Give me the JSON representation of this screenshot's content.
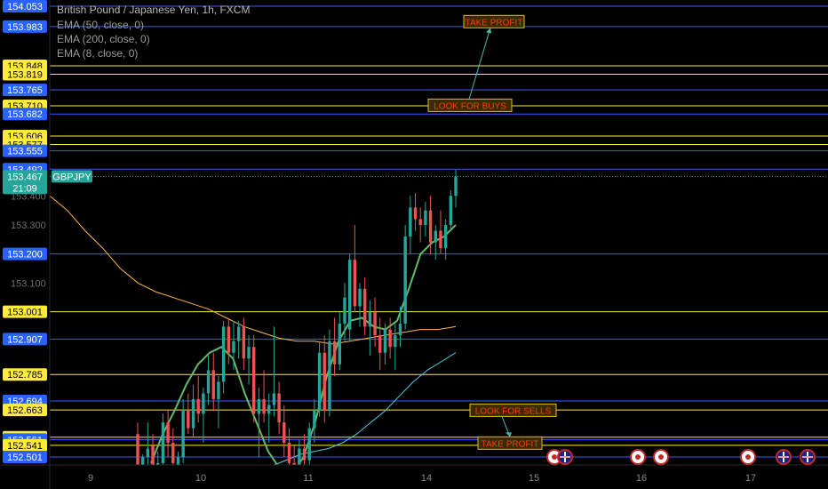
{
  "header": {
    "title": "British Pound / Japanese Yen, 1h, FXCM",
    "indicators": [
      "EMA (50, close, 0)",
      "EMA (200, close, 0)",
      "EMA (8, close, 0)"
    ]
  },
  "colors": {
    "background": "#000000",
    "up_candle": "#26a69a",
    "down_candle": "#ef5350",
    "blue_level": "#3d5afe",
    "yellow_level": "#ffeb3b",
    "ema50": "#ffb74d",
    "ema200": "#4dd0e1",
    "ema8": "#66bb6a",
    "annotation_text": "#ff3d00"
  },
  "chart_data": {
    "type": "candlestick",
    "symbol": "GBPJPY",
    "timeframe": "1h",
    "ylim": [
      152.45,
      154.08
    ],
    "x_ticks": [
      "9",
      "10",
      "11",
      "14",
      "15",
      "16",
      "17"
    ],
    "y_ticks": [
      "153.400",
      "153.300",
      "153.100"
    ],
    "levels": [
      {
        "price": 154.053,
        "color": "blue"
      },
      {
        "price": 153.983,
        "color": "blue"
      },
      {
        "price": 153.848,
        "color": "yellow"
      },
      {
        "price": 153.819,
        "color": "yellow"
      },
      {
        "price": 153.765,
        "color": "blue"
      },
      {
        "price": 153.71,
        "color": "yellow"
      },
      {
        "price": 153.682,
        "color": "blue"
      },
      {
        "price": 153.606,
        "color": "yellow"
      },
      {
        "price": 153.577,
        "color": "yellow"
      },
      {
        "price": 153.555,
        "color": "blue"
      },
      {
        "price": 153.492,
        "color": "blue"
      },
      {
        "price": 153.2,
        "color": "blue"
      },
      {
        "price": 153.001,
        "color": "yellow"
      },
      {
        "price": 152.907,
        "color": "blue"
      },
      {
        "price": 152.785,
        "color": "yellow"
      },
      {
        "price": 152.694,
        "color": "blue"
      },
      {
        "price": 152.663,
        "color": "yellow"
      },
      {
        "price": 152.569,
        "color": "yellow"
      },
      {
        "price": 152.561,
        "color": "blue"
      },
      {
        "price": 152.541,
        "color": "yellow"
      },
      {
        "price": 152.501,
        "color": "blue"
      }
    ],
    "current": {
      "symbol": "GBPJPY",
      "price": "153.467",
      "countdown": "21:09"
    },
    "annotations": [
      {
        "text": "TAKE PROFIT",
        "price": 154.0
      },
      {
        "text": "LOOK FOR BUYS",
        "price": 153.712
      },
      {
        "text": "LOOK FOR SELLS",
        "price": 152.662
      },
      {
        "text": "TAKE PROFIT",
        "price": 152.549
      }
    ],
    "candles": [
      [
        152.58,
        152.62,
        152.4,
        152.45
      ],
      [
        152.44,
        152.51,
        152.38,
        152.5
      ],
      [
        152.5,
        152.62,
        152.46,
        152.53
      ],
      [
        152.54,
        152.58,
        152.42,
        152.45
      ],
      [
        152.45,
        152.52,
        152.38,
        152.48
      ],
      [
        152.48,
        152.65,
        152.45,
        152.62
      ],
      [
        152.62,
        152.66,
        152.5,
        152.55
      ],
      [
        152.55,
        152.6,
        152.44,
        152.48
      ],
      [
        152.47,
        152.52,
        152.4,
        152.5
      ],
      [
        152.5,
        152.7,
        152.48,
        152.66
      ],
      [
        152.66,
        152.72,
        152.58,
        152.6
      ],
      [
        152.6,
        152.75,
        152.57,
        152.7
      ],
      [
        152.7,
        152.78,
        152.62,
        152.65
      ],
      [
        152.65,
        152.74,
        152.55,
        152.72
      ],
      [
        152.72,
        152.85,
        152.68,
        152.8
      ],
      [
        152.8,
        152.86,
        152.66,
        152.7
      ],
      [
        152.7,
        152.78,
        152.6,
        152.76
      ],
      [
        152.76,
        152.97,
        152.72,
        152.95
      ],
      [
        152.95,
        152.98,
        152.82,
        152.86
      ],
      [
        152.86,
        152.97,
        152.8,
        152.9
      ],
      [
        152.9,
        152.97,
        152.84,
        152.95
      ],
      [
        152.95,
        152.98,
        152.8,
        152.84
      ],
      [
        152.84,
        152.92,
        152.75,
        152.88
      ],
      [
        152.88,
        152.92,
        152.62,
        152.65
      ],
      [
        152.65,
        152.74,
        152.5,
        152.7
      ],
      [
        152.7,
        152.8,
        152.62,
        152.65
      ],
      [
        152.65,
        152.72,
        152.55,
        152.68
      ],
      [
        152.68,
        152.95,
        152.64,
        152.72
      ],
      [
        152.72,
        152.76,
        152.58,
        152.62
      ],
      [
        152.62,
        152.68,
        152.5,
        152.55
      ],
      [
        152.55,
        152.6,
        152.44,
        152.48
      ],
      [
        152.48,
        152.54,
        152.4,
        152.45
      ],
      [
        152.44,
        152.56,
        152.42,
        152.53
      ],
      [
        152.53,
        152.58,
        152.45,
        152.49
      ],
      [
        152.49,
        152.62,
        152.47,
        152.6
      ],
      [
        152.6,
        152.7,
        152.55,
        152.66
      ],
      [
        152.66,
        152.9,
        152.64,
        152.86
      ],
      [
        152.86,
        152.92,
        152.62,
        152.66
      ],
      [
        152.66,
        152.94,
        152.64,
        152.9
      ],
      [
        152.9,
        152.98,
        152.78,
        152.82
      ],
      [
        152.82,
        153.0,
        152.8,
        152.96
      ],
      [
        152.96,
        153.1,
        152.9,
        153.05
      ],
      [
        152.94,
        153.2,
        152.9,
        153.18
      ],
      [
        153.18,
        153.3,
        153.0,
        153.02
      ],
      [
        153.02,
        153.1,
        152.95,
        153.08
      ],
      [
        153.08,
        153.12,
        152.92,
        152.95
      ],
      [
        152.95,
        153.04,
        152.85,
        153.0
      ],
      [
        153.0,
        153.05,
        152.88,
        152.92
      ],
      [
        152.92,
        152.98,
        152.8,
        152.86
      ],
      [
        152.86,
        152.96,
        152.82,
        152.94
      ],
      [
        152.94,
        152.98,
        152.84,
        152.88
      ],
      [
        152.88,
        152.96,
        152.8,
        152.92
      ],
      [
        152.92,
        153.02,
        152.88,
        152.96
      ],
      [
        152.96,
        153.3,
        152.94,
        153.26
      ],
      [
        153.26,
        153.4,
        153.2,
        153.36
      ],
      [
        153.36,
        153.41,
        153.28,
        153.32
      ],
      [
        153.32,
        153.36,
        153.24,
        153.3
      ],
      [
        153.3,
        153.38,
        153.26,
        153.35
      ],
      [
        153.35,
        153.4,
        153.2,
        153.24
      ],
      [
        153.24,
        153.3,
        153.18,
        153.28
      ],
      [
        153.28,
        153.35,
        153.2,
        153.22
      ],
      [
        153.22,
        153.32,
        153.18,
        153.3
      ],
      [
        153.3,
        153.42,
        153.28,
        153.4
      ],
      [
        153.4,
        153.49,
        153.36,
        153.467
      ]
    ],
    "ema50": [
      [
        152.44,
        152.42
      ],
      [
        152.48,
        152.47
      ],
      [
        152.54,
        152.49
      ],
      [
        152.58,
        152.51
      ],
      [
        152.61,
        152.52
      ],
      [
        152.64,
        152.53
      ],
      [
        152.68,
        152.55
      ],
      [
        152.72,
        152.58
      ],
      [
        152.76,
        152.62
      ],
      [
        152.8,
        152.66
      ],
      [
        152.84,
        152.71
      ],
      [
        152.88,
        152.76
      ],
      [
        152.92,
        152.8
      ],
      [
        152.96,
        152.83
      ],
      [
        152.99,
        152.86
      ]
    ],
    "ema200": [
      [
        152.54,
        153.4
      ],
      [
        152.58,
        153.35
      ],
      [
        152.62,
        153.28
      ],
      [
        152.66,
        153.22
      ],
      [
        152.72,
        153.15
      ],
      [
        152.78,
        153.1
      ],
      [
        152.84,
        153.07
      ],
      [
        152.9,
        153.05
      ],
      [
        152.96,
        153.03
      ],
      [
        153.02,
        153.01
      ],
      [
        153.08,
        152.98
      ],
      [
        153.14,
        152.95
      ],
      [
        153.2,
        152.93
      ],
      [
        153.26,
        152.91
      ],
      [
        153.32,
        152.9
      ],
      [
        153.38,
        152.9
      ],
      [
        153.44,
        152.89
      ],
      [
        153.5,
        152.9
      ],
      [
        153.56,
        152.91
      ],
      [
        153.62,
        152.92
      ],
      [
        153.66,
        152.93
      ],
      [
        153.7,
        152.94
      ],
      [
        153.74,
        152.94
      ],
      [
        153.78,
        152.95
      ]
    ],
    "ema8": [
      [
        152.54,
        152.48
      ],
      [
        152.58,
        152.58
      ],
      [
        152.62,
        152.66
      ],
      [
        152.66,
        152.75
      ],
      [
        152.7,
        152.82
      ],
      [
        152.74,
        152.86
      ],
      [
        152.78,
        152.88
      ],
      [
        152.8,
        152.84
      ],
      [
        152.84,
        152.72
      ],
      [
        152.88,
        152.62
      ],
      [
        152.92,
        152.52
      ],
      [
        152.96,
        152.46
      ],
      [
        153.02,
        152.44
      ],
      [
        153.06,
        152.5
      ],
      [
        153.1,
        152.62
      ],
      [
        153.14,
        152.78
      ],
      [
        153.18,
        152.9
      ],
      [
        153.22,
        152.97
      ],
      [
        153.26,
        152.98
      ],
      [
        153.3,
        152.95
      ],
      [
        153.34,
        152.94
      ],
      [
        153.38,
        152.97
      ],
      [
        153.4,
        153.08
      ],
      [
        153.42,
        153.2
      ],
      [
        153.46,
        153.24
      ],
      [
        153.5,
        153.26
      ],
      [
        153.54,
        153.3
      ]
    ]
  }
}
